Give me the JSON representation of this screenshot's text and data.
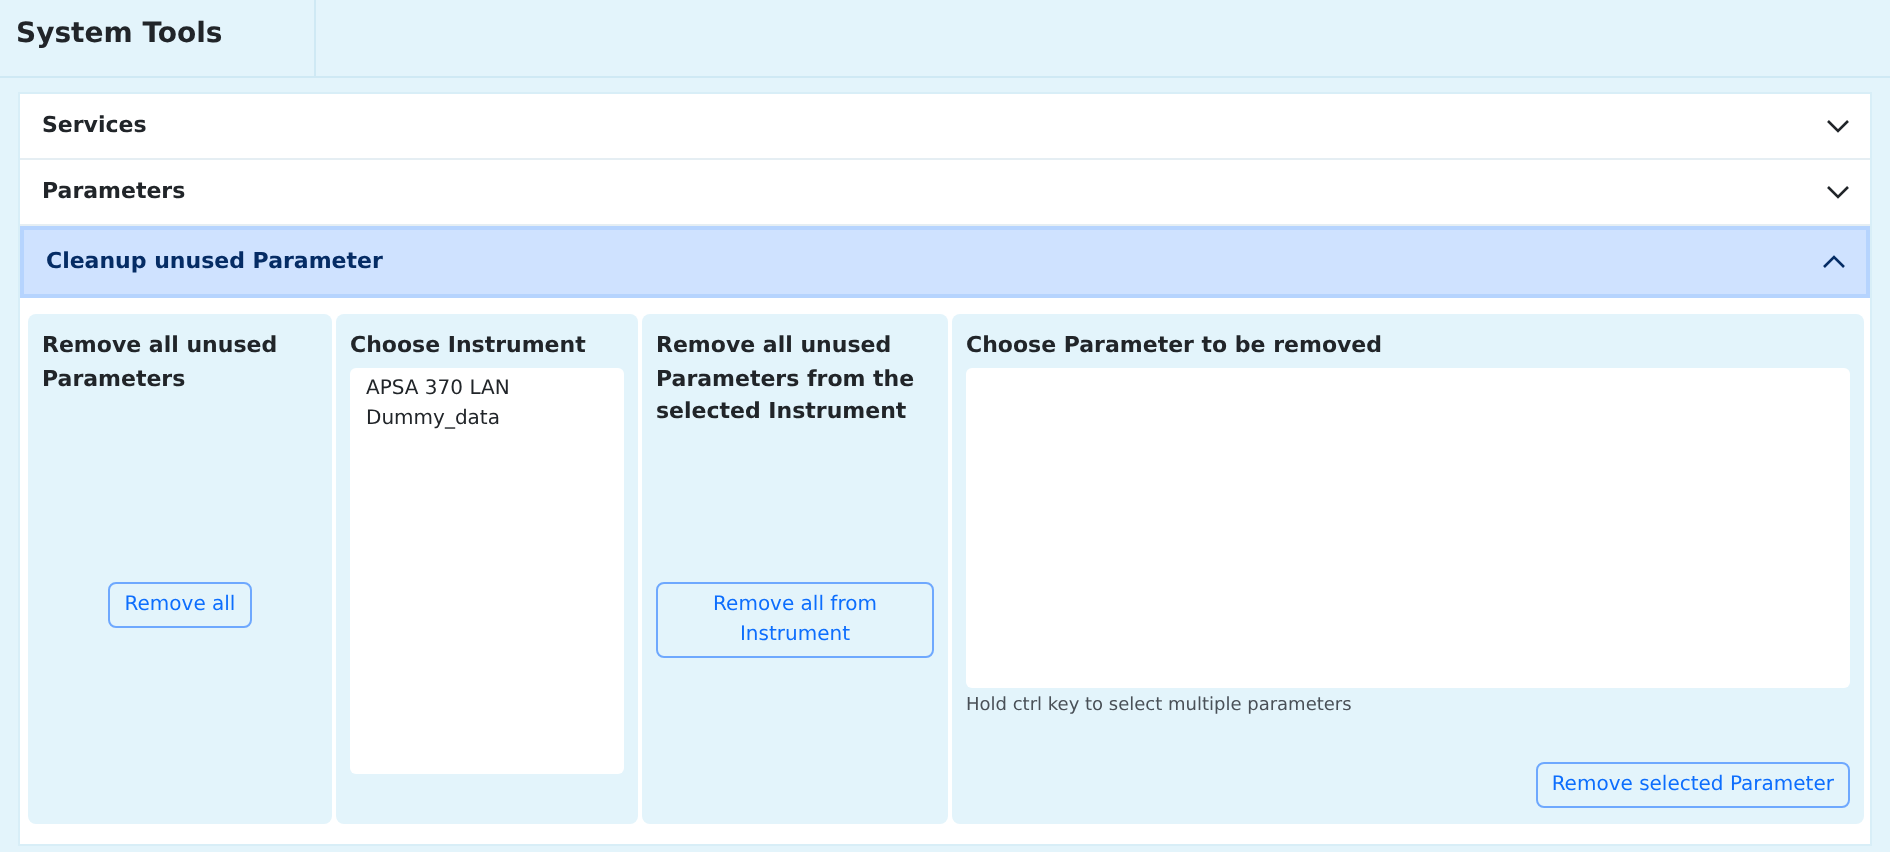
{
  "header": {
    "title": "System Tools"
  },
  "accordion": [
    {
      "label": "Services",
      "expanded": false
    },
    {
      "label": "Parameters",
      "expanded": false
    },
    {
      "label": "Cleanup unused Parameter",
      "expanded": true,
      "panels": [
        {
          "kind": "action",
          "heading": "Remove all unused Parameters",
          "button": "Remove all"
        },
        {
          "kind": "list",
          "heading": "Choose Instrument",
          "options": [
            {
              "label": "APSA 370 LAN",
              "selected": false
            },
            {
              "label": "Dummy_data",
              "selected": false
            }
          ]
        },
        {
          "kind": "action",
          "heading": "Remove all unused Parameters from the selected Instrument",
          "button": "Remove all from Instrument"
        },
        {
          "kind": "list",
          "heading": "Choose Parameter to be removed",
          "hint": "Hold ctrl key to select multiple parameters",
          "button": "Remove selected Parameter"
        }
      ]
    }
  ]
}
